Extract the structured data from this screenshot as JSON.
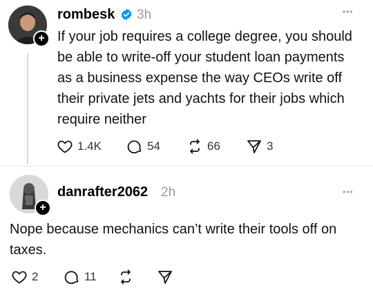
{
  "posts": [
    {
      "username": "rombesk",
      "verified": true,
      "time": "3h",
      "text": "If your job requires a college degree, you should be able to write-off your student loan payments as a business expense the way CEOs write off their private jets and yachts for their jobs which require neither",
      "likes": "1.4K",
      "replies": "54",
      "reposts": "66",
      "shares": "3"
    },
    {
      "username": "danrafter2062",
      "verified": false,
      "time": "2h",
      "text": "Nope because mechanics can’t write their tools off on taxes.",
      "likes": "2",
      "replies": "11",
      "reposts": "",
      "shares": ""
    }
  ],
  "icons": {
    "more": "more-icon",
    "like": "heart-icon",
    "reply": "comment-icon",
    "repost": "repost-icon",
    "share": "send-icon",
    "follow": "plus-icon",
    "verified": "verified-badge-icon"
  },
  "colors": {
    "verified": "#0095f6",
    "muted": "#9a9a9a",
    "thread_line": "#d9d9d9"
  },
  "labels": {
    "follow_glyph": "+",
    "more_glyph": "•••"
  }
}
